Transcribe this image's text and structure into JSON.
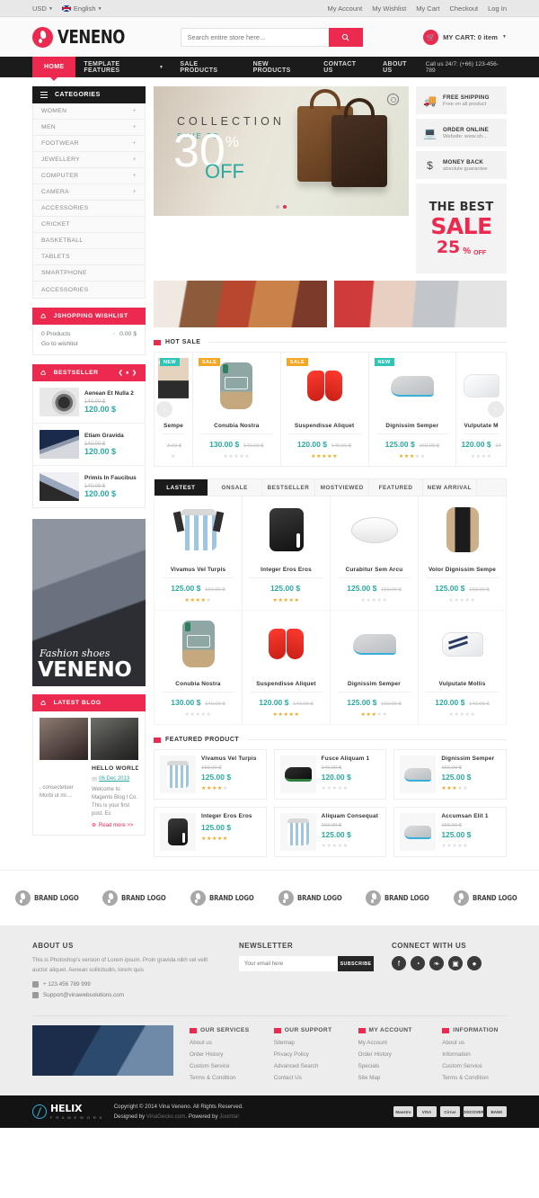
{
  "topbar": {
    "currency": "USD",
    "language": "English",
    "links": [
      "My Account",
      "My Wishlist",
      "My Cart",
      "Checkout",
      "Log In"
    ]
  },
  "header": {
    "logo_text": "VENENO",
    "search_placeholder": "Search entire store here...",
    "search_icon": "search-icon",
    "cart_label": "MY CART: 0 item"
  },
  "nav": {
    "items": [
      "HOME",
      "TEMPLATE FEATURES",
      "SALE PRODUCTS",
      "NEW PRODUCTS",
      "CONTACT US",
      "ABOUT US"
    ],
    "active": "HOME",
    "phone": "Call us 24/7: (+66) 123-456-789"
  },
  "sidebar": {
    "categories_title": "CATEGORIES",
    "categories": [
      {
        "label": "WOMEN",
        "expandable": true
      },
      {
        "label": "MEN",
        "expandable": true
      },
      {
        "label": "FOOTWEAR",
        "expandable": true
      },
      {
        "label": "JEWELLERY",
        "expandable": true
      },
      {
        "label": "COMPUTER",
        "expandable": true
      },
      {
        "label": "CAMERA",
        "expandable": true
      },
      {
        "label": "ACCESSORIES",
        "expandable": false
      },
      {
        "label": "CRICKET",
        "expandable": false
      },
      {
        "label": "BASKETBALL",
        "expandable": false
      },
      {
        "label": "TABLETS",
        "expandable": false
      },
      {
        "label": "SMARTPHONE",
        "expandable": false
      },
      {
        "label": "ACCESSORIES",
        "expandable": false
      }
    ],
    "wishlist": {
      "title": "JSHOPPING WISHLIST",
      "products": "0 Products",
      "dash": "-",
      "total": "0.00 $",
      "link": "Go to wishlist"
    },
    "bestseller": {
      "title": "BESTSELLER",
      "items": [
        {
          "name": "Aenean Et Nulla 2",
          "old": "140.00 $",
          "new": "120.00 $",
          "image": "camera"
        },
        {
          "name": "Etiam Gravida",
          "old": "140.00 $",
          "new": "120.00 $",
          "image": "laptop"
        },
        {
          "name": "Primis In Faucibus",
          "old": "140.00 $",
          "new": "120.00 $",
          "image": "laptop2"
        }
      ]
    },
    "banner": {
      "caption_script": "Fashion shoes",
      "caption_big": "VENENO"
    },
    "blog": {
      "title": "LATEST BLOG",
      "post_left": {
        "excerpt": ", consectetuer Morbi ut mi...."
      },
      "post_right": {
        "title": "HELLO WORLD",
        "date": "06  Dec  2013",
        "excerpt": "Welcome to Magento Blog l Co. This is your first post. Ec",
        "readmore": "Read more >>"
      }
    }
  },
  "slider": {
    "collection": "COLLECTION",
    "save_to": "SAVE TO",
    "number": "30",
    "percent": "%",
    "off": "OFF"
  },
  "features": [
    {
      "icon": "truck-icon",
      "glyph": "🚚",
      "title": "FREE SHIPPING",
      "sub": "Free on all product"
    },
    {
      "icon": "laptop-icon",
      "glyph": "💻",
      "title": "ORDER ONLINE",
      "sub": "Website: www.sh..."
    },
    {
      "icon": "dollar-icon",
      "glyph": "$",
      "title": "MONEY BACK",
      "sub": "absolute guarantee"
    }
  ],
  "sale_promo": {
    "line1": "THE BEST",
    "line2": "SALE",
    "number": "25",
    "percent": "%",
    "off": "OFF"
  },
  "hot_sale": {
    "title": "HOT SALE",
    "prev_icon": "chevron-left-icon",
    "next_icon": "chevron-right-icon",
    "products": [
      {
        "name": "Sempe",
        "new": "",
        "old": "3.00 $",
        "badge": "NEW",
        "badge_type": "new",
        "stars": 0,
        "image": "shoe-partial",
        "partial": true
      },
      {
        "name": "Conubia Nostra",
        "new": "130.00 $",
        "old": "140.00 $",
        "badge": "SALE",
        "badge_type": "sale",
        "stars": 0,
        "image": "backpack-grey"
      },
      {
        "name": "Suspendisse Aliquet",
        "new": "120.00 $",
        "old": "140.00 $",
        "badge": "SALE",
        "badge_type": "sale",
        "stars": 4.5,
        "image": "gloves"
      },
      {
        "name": "Dignissim Semper",
        "new": "125.00 $",
        "old": "160.00 $",
        "badge": "NEW",
        "badge_type": "new",
        "stars": 3,
        "image": "sneaker-grey"
      },
      {
        "name": "Vulputate M",
        "new": "120.00 $",
        "old": "14",
        "badge": "",
        "badge_type": "",
        "stars": 0,
        "image": "sneaker-white",
        "partial": true
      }
    ]
  },
  "tabs": {
    "items": [
      "LASTEST",
      "ONSALE",
      "BESTSELLER",
      "MOSTVIEWED",
      "FEATURED",
      "NEW ARRIVAL"
    ],
    "active": "LASTEST",
    "row1": [
      {
        "name": "Vivamus Vel Turpis",
        "new": "125.00 $",
        "old": "160.00 $",
        "stars": 4,
        "image": "jersey"
      },
      {
        "name": "Integer Eros Eros",
        "new": "125.00 $",
        "old": "",
        "stars": 5,
        "image": "polo-black"
      },
      {
        "name": "Curabitur Sem Arcu",
        "new": "125.00 $",
        "old": "160.00 $",
        "stars": 0,
        "image": "ball"
      },
      {
        "name": "Volor Dignissim Sempe",
        "new": "125.00 $",
        "old": "160.00 $",
        "stars": 0,
        "image": "backpack-tan"
      }
    ],
    "row2": [
      {
        "name": "Conubia Nostra",
        "new": "130.00 $",
        "old": "140.00 $",
        "stars": 0,
        "image": "backpack-grey"
      },
      {
        "name": "Suspendisse Aliquet",
        "new": "120.00 $",
        "old": "140.00 $",
        "stars": 4.5,
        "image": "gloves"
      },
      {
        "name": "Dignissim Semper",
        "new": "125.00 $",
        "old": "160.00 $",
        "stars": 3,
        "image": "sneaker-grey"
      },
      {
        "name": "Vulputate Mollis",
        "new": "120.00 $",
        "old": "140.00 $",
        "stars": 0,
        "image": "sneaker-white"
      }
    ]
  },
  "featured_product": {
    "title": "FEATURED PRODUCT",
    "items": [
      {
        "name": "Vivamus Vel Turpis",
        "old": "160.00 $",
        "new": "125.00 $",
        "stars": 4,
        "image": "jersey"
      },
      {
        "name": "Fusce Aliquam 1",
        "old": "140.00 $",
        "new": "120.00 $",
        "stars": 0,
        "image": "shoe-black"
      },
      {
        "name": "Dignissim Semper",
        "old": "160.00 $",
        "new": "125.00 $",
        "stars": 3,
        "image": "sneaker-grey"
      },
      {
        "name": "Integer Eros Eros",
        "old": "",
        "new": "125.00 $",
        "stars": 5,
        "image": "polo-black"
      },
      {
        "name": "Aliquam Consequat",
        "old": "160.00 $",
        "new": "125.00 $",
        "stars": 0,
        "image": "jersey"
      },
      {
        "name": "Accumsan Elit 1",
        "old": "160.00 $",
        "new": "125.00 $",
        "stars": 0,
        "image": "sneaker-grey"
      }
    ]
  },
  "brands": [
    "BRAND LOGO",
    "BRAND LOGO",
    "BRAND LOGO",
    "BRAND LOGO",
    "BRAND LOGO",
    "BRAND LOGO"
  ],
  "footer": {
    "about": {
      "title": "ABOUT US",
      "text": "This is Photoshop's version of Lorem ipsum. Proin gravida nibh vel velit auctor aliquet. Aenean sollicitudin, lorem quis",
      "phone": "+ 123.456 789 999",
      "email": "Support@vinawebsolutions.com"
    },
    "newsletter": {
      "title": "NEWSLETTER",
      "placeholder": "Your email here",
      "button": "SUBSCRIBE"
    },
    "connect": {
      "title": "CONNECT WITH US",
      "socials": [
        "facebook-icon",
        "rss-icon",
        "twitter-icon",
        "instagram-icon",
        "dribbble-icon"
      ],
      "glyphs": [
        "f",
        "◔",
        "❧",
        "▣",
        "●"
      ]
    },
    "columns": [
      {
        "title": "OUR SERVICES",
        "links": [
          "About us",
          "Order History",
          "Custom Service",
          "Terms & Condition"
        ]
      },
      {
        "title": "OUR SUPPORT",
        "links": [
          "Sitemap",
          "Privacy Policy",
          "Advanced Search",
          "Contact Us"
        ]
      },
      {
        "title": "MY ACCOUNT",
        "links": [
          "My Account",
          "Order History",
          "Specials",
          "Site Map"
        ]
      },
      {
        "title": "INFORMATION",
        "links": [
          "About us",
          "Information",
          "Custom Service",
          "Terms & Condition"
        ]
      }
    ]
  },
  "copyright": {
    "helix_name": "HELIX",
    "helix_sub": "F R A M E W O R K",
    "line1": "Copyright © 2014 Vina Veneno. All Rights Reserved.",
    "designed_by": "Designed by",
    "designer": "VinaGecko.com",
    "powered_by": ". Powered by",
    "platform": "Joomla!",
    "payments": [
      "Maestro",
      "VISA",
      "Cirrus",
      "DISCOVER",
      "BANK"
    ]
  },
  "colors": {
    "accent": "#ec2a4f",
    "teal": "#2aa9a0",
    "dark": "#1b1b1b"
  }
}
